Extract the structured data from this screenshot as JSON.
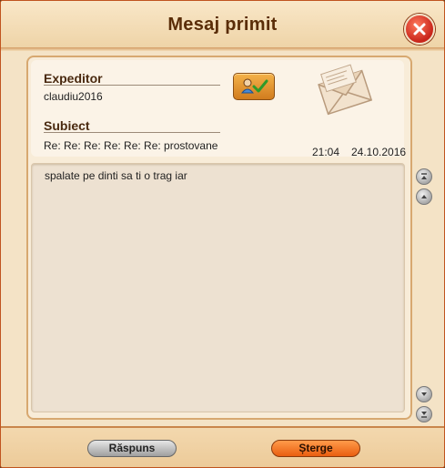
{
  "window": {
    "title": "Mesaj primit"
  },
  "header": {
    "sender_label": "Expeditor",
    "sender_value": "claudiu2016",
    "subject_label": "Subiect",
    "subject_value": "Re: Re: Re: Re: Re: Re: prostovane",
    "time": "21:04",
    "date": "24.10.2016"
  },
  "message": {
    "body": "spalate pe dinti sa ti o trag iar"
  },
  "footer": {
    "reply_label": "Răspuns",
    "delete_label": "Șterge"
  },
  "icons": {
    "close": "close-icon",
    "add_friend": "add-contact-icon",
    "envelope": "envelope-icon",
    "scroll_top": "scroll-top-icon",
    "scroll_up": "scroll-up-icon",
    "scroll_down": "scroll-down-icon",
    "scroll_bottom": "scroll-bottom-icon"
  },
  "colors": {
    "accent": "#e95e10",
    "title": "#5a2d08",
    "close": "#c8241a"
  }
}
